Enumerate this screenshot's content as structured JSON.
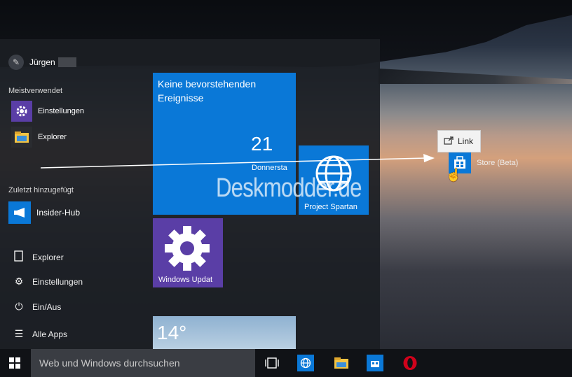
{
  "user": {
    "name": "Jürgen"
  },
  "sections": {
    "most_used": "Meistverwendet",
    "recently_added": "Zuletzt hinzugefügt"
  },
  "most_used": [
    {
      "label": "Einstellungen",
      "icon": "gear-icon"
    },
    {
      "label": "Explorer",
      "icon": "folder-icon"
    }
  ],
  "recent": [
    {
      "label": "Insider-Hub",
      "icon": "megaphone-icon"
    }
  ],
  "bottom_items": [
    {
      "label": "Explorer",
      "icon": "document-icon"
    },
    {
      "label": "Einstellungen",
      "icon": "gear-icon"
    },
    {
      "label": "Ein/Aus",
      "icon": "power-icon"
    },
    {
      "label": "Alle Apps",
      "icon": "list-icon"
    }
  ],
  "tiles": {
    "calendar": {
      "text": "Keine bevorstehenden Ereignisse",
      "day": "21",
      "weekday": "Donnersta"
    },
    "spartan": {
      "label": "Project Spartan"
    },
    "update": {
      "label": "Windows Updat"
    },
    "weather": {
      "temp": "14°"
    }
  },
  "watermark": "Deskmodder.de",
  "drag": {
    "tooltip": "Link",
    "item_label": "Store (Beta)"
  },
  "taskbar": {
    "search_placeholder": "Web und Windows durchsuchen"
  },
  "colors": {
    "accent": "#0a78d7",
    "update_tile": "#5a3ea6",
    "taskbar": "#101216"
  }
}
